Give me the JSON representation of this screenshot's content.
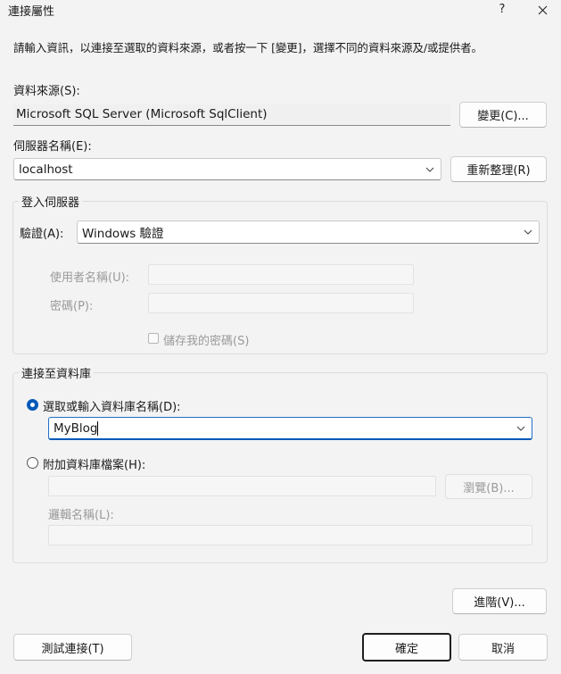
{
  "window": {
    "title": "連接屬性",
    "help_label": "?",
    "close_label": "✕"
  },
  "intro_text": "請輸入資訊，以連接至選取的資料來源，或者按一下 [變更]，選擇不同的資料來源及/或提供者。",
  "data_source": {
    "label": "資料來源(S):",
    "value": "Microsoft SQL Server (Microsoft SqlClient)",
    "change_button": "變更(C)..."
  },
  "server": {
    "label": "伺服器名稱(E):",
    "value": "localhost",
    "refresh_button": "重新整理(R)"
  },
  "login": {
    "group_title": "登入伺服器",
    "auth_label": "驗證(A):",
    "auth_value": "Windows 驗證",
    "username_label": "使用者名稱(U):",
    "username_value": "",
    "password_label": "密碼(P):",
    "password_value": "",
    "save_password_label": "儲存我的密碼(S)"
  },
  "database": {
    "group_title": "連接至資料庫",
    "select_option_label": "選取或輸入資料庫名稱(D):",
    "db_name_value": "MyBlog",
    "attach_option_label": "附加資料庫檔案(H):",
    "attach_file_value": "",
    "browse_button": "瀏覽(B)...",
    "logical_name_label": "邏輯名稱(L):",
    "logical_name_value": ""
  },
  "advanced_button": "進階(V)...",
  "footer": {
    "test_button": "測試連接(T)",
    "ok_button": "確定",
    "cancel_button": "取消"
  },
  "colors": {
    "accent": "#0058b8",
    "background": "#f3f3f3"
  }
}
